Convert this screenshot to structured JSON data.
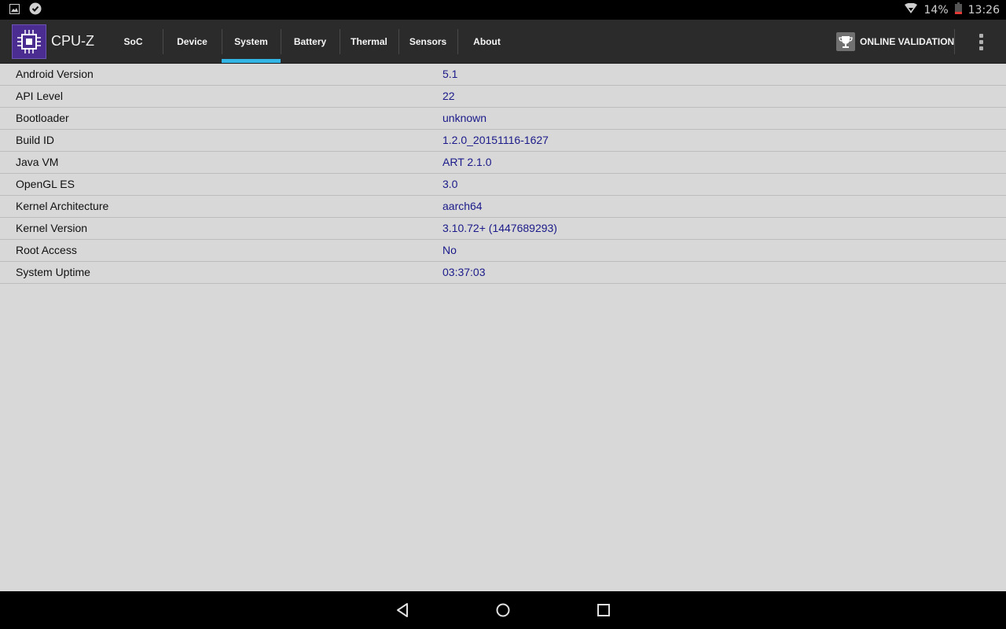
{
  "status_bar": {
    "battery_percent": "14%",
    "clock": "13:26",
    "icons": [
      "image-notification-icon",
      "check-badge-notification-icon",
      "wifi-icon",
      "battery-icon"
    ]
  },
  "app": {
    "title": "CPU-Z",
    "logo_icon": "cpu-chip-icon",
    "accent_color": "#33b5e5",
    "logo_color": "#4b2c91"
  },
  "tabs": [
    {
      "label": "SoC",
      "active": false
    },
    {
      "label": "Device",
      "active": false
    },
    {
      "label": "System",
      "active": true
    },
    {
      "label": "Battery",
      "active": false
    },
    {
      "label": "Thermal",
      "active": false
    },
    {
      "label": "Sensors",
      "active": false
    },
    {
      "label": "About",
      "active": false
    }
  ],
  "validation": {
    "label": "ONLINE VALIDATION",
    "icon": "trophy-icon"
  },
  "system_info": [
    {
      "label": "Android Version",
      "value": "5.1"
    },
    {
      "label": "API Level",
      "value": "22"
    },
    {
      "label": "Bootloader",
      "value": "unknown"
    },
    {
      "label": "Build ID",
      "value": "1.2.0_20151116-1627"
    },
    {
      "label": "Java VM",
      "value": "ART 2.1.0"
    },
    {
      "label": "OpenGL ES",
      "value": "3.0"
    },
    {
      "label": "Kernel Architecture",
      "value": "aarch64"
    },
    {
      "label": "Kernel Version",
      "value": "3.10.72+ (1447689293)"
    },
    {
      "label": "Root Access",
      "value": "No"
    },
    {
      "label": "System Uptime",
      "value": "03:37:03"
    }
  ],
  "nav_bar": {
    "buttons": [
      "back-icon",
      "home-icon",
      "recents-icon"
    ]
  }
}
